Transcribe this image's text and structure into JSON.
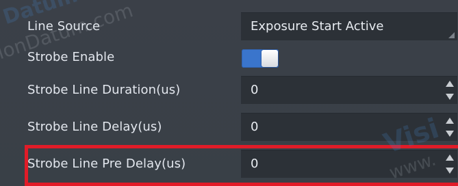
{
  "properties": {
    "line_source": {
      "label": "Line Source",
      "value": "Exposure Start Active"
    },
    "strobe_enable": {
      "label": "Strobe Enable",
      "checked": true
    },
    "strobe_line_duration": {
      "label": "Strobe Line Duration(us)",
      "value": "0"
    },
    "strobe_line_delay": {
      "label": "Strobe Line Delay(us)",
      "value": "0"
    },
    "strobe_line_pre_delay": {
      "label": "Strobe Line Pre Delay(us)",
      "value": "0"
    }
  },
  "watermarks": {
    "top_brand": "Datum",
    "top_url": "ionDatum.com",
    "bottom_brand": "Visi",
    "bottom_url": "www."
  },
  "colors": {
    "background": "#3a3f47",
    "field_background": "#2c3137",
    "toggle_on": "#3a75cc",
    "highlight": "#e11c28"
  }
}
